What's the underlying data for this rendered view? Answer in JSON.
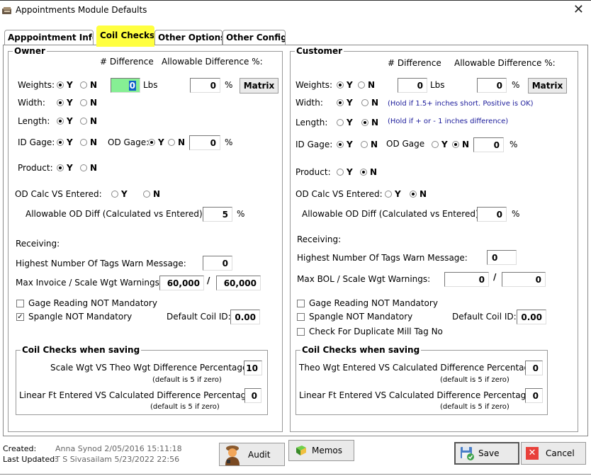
{
  "window": {
    "title": "Appointments Module Defaults",
    "close_label": "✕"
  },
  "tabs": [
    {
      "label": "Apppointment Info"
    },
    {
      "label": "Coil Checks",
      "active": true
    },
    {
      "label": "Other Options"
    },
    {
      "label": "Other Config"
    }
  ],
  "owner": {
    "title": "Owner",
    "hdr_diff": "# Difference",
    "hdr_allow": "Allowable Difference %:",
    "weights_label": "Weights:",
    "width_label": "Width:",
    "length_label": "Length:",
    "idgage_label": "ID Gage:",
    "odgage_label": "OD Gage:",
    "product_label": "Product:",
    "yes": "Y",
    "no": "N",
    "weights_value": "Y",
    "width_value": "Y",
    "length_value": "Y",
    "idgage_value": "Y",
    "odgage_value": "Y",
    "product_value": "Y",
    "weights_diff": "0",
    "lbs": "Lbs",
    "weights_pct": "0",
    "pct": "%",
    "matrix": "Matrix",
    "odgage_pct": "0",
    "odcalc_label": "OD Calc VS Entered:",
    "odcalc_value": null,
    "allow_od_label": "Allowable OD Diff (Calculated vs Entered):",
    "allow_od_value": "5",
    "receiving_label": "Receiving:",
    "tags_label": "Highest Number Of Tags Warn Message:",
    "tags_value": "0",
    "max_label": "Max Invoice / Scale Wgt Warnings:",
    "max_value1": "60,000",
    "max_value2": "60,000",
    "slash": "/",
    "gage_reading": "Gage Reading NOT Mandatory",
    "gage_reading_checked": false,
    "spangle": "Spangle NOT Mandatory",
    "spangle_checked": true,
    "coil_id_label": "Default Coil ID:",
    "coil_id_value": "0.00",
    "saving_title": "Coil Checks when saving",
    "scale_label": "Scale Wgt VS Theo Wgt Difference Percentage:",
    "scale_value": "10",
    "default_note": "(default is 5 if zero)",
    "linear_label": "Linear Ft Entered VS Calculated Difference Percentage:",
    "linear_value": "0"
  },
  "customer": {
    "title": "Customer",
    "hdr_diff": "# Difference",
    "hdr_allow": "Allowable Difference %:",
    "weights_label": "Weights:",
    "width_label": "Width:",
    "length_label": "Length:",
    "idgage_label": "ID Gage:",
    "odgage_label": "OD Gage",
    "product_label": "Product:",
    "yes": "Y",
    "no": "N",
    "weights_value": "Y",
    "width_value": "Y",
    "length_value": "N",
    "idgage_value": "Y",
    "odgage_value": "N",
    "product_value": "N",
    "weights_diff": "0",
    "lbs": "Lbs",
    "weights_pct": "0",
    "pct": "%",
    "matrix": "Matrix",
    "width_note": "(Hold if 1.5+ inches short. Positive is OK)",
    "length_note": "(Hold if + or - 1 inches difference)",
    "odgage_pct": "0",
    "odcalc_label": "OD Calc VS Entered:",
    "odcalc_value": "N",
    "allow_od_label": "Allowable OD Diff (Calculated vs Entered):",
    "allow_od_value": "0",
    "receiving_label": "Receiving:",
    "tags_label": "Highest Number Of Tags Warn Message:",
    "tags_value": "0",
    "max_label": "Max BOL / Scale Wgt Warnings:",
    "max_value1": "0",
    "max_value2": "0",
    "slash": "/",
    "gage_reading": "Gage Reading NOT Mandatory",
    "gage_reading_checked": false,
    "spangle": "Spangle NOT Mandatory",
    "spangle_checked": false,
    "dup_mill": "Check For Duplicate Mill Tag No",
    "dup_mill_checked": false,
    "coil_id_label": "Default Coil ID:",
    "coil_id_value": "0.00",
    "saving_title": "Coil Checks when saving",
    "theo_label": "Theo Wgt Entered VS Calculated Difference Percentage",
    "theo_value": "0",
    "default_note": "(default is 5 if zero)",
    "linear_label": "Linear Ft Entered VS Calculated Difference Percentage:",
    "linear_value": "0"
  },
  "footer": {
    "created_label": "Created:",
    "created_value": "Anna Synod 2/05/2016 15:11:18",
    "updated_label": "Last Updated:",
    "updated_value": "T S Sivasailam 5/23/2022 22:56",
    "audit": "Audit",
    "memos": "Memos",
    "save": "Save",
    "cancel": "Cancel"
  },
  "colors": {
    "active_tab": "#ffff40",
    "focused_input": "#86ef94",
    "note_text": "#1a1a9a",
    "cancel_red": "#e8403a"
  }
}
